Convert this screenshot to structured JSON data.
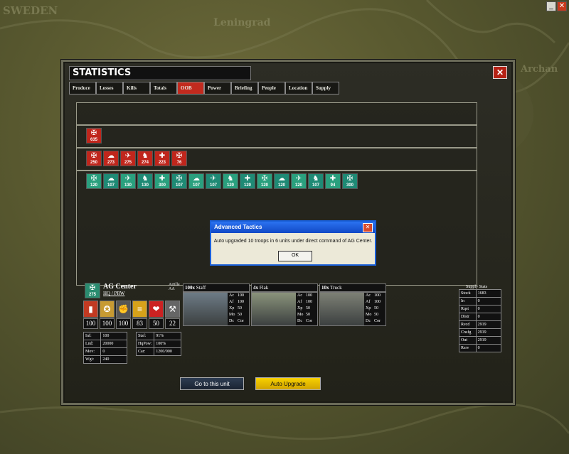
{
  "map": {
    "label_sweden": "SWEDEN",
    "label_leningrad": "Leningrad",
    "label_archangel": "Archan"
  },
  "window_controls": {
    "minimize": "_",
    "close": "✕"
  },
  "title": "STATISTICS",
  "tabs": [
    "Produce",
    "Losses",
    "Kills",
    "Totals",
    "OOB",
    "Power",
    "Briefing",
    "People",
    "Location",
    "Supply"
  ],
  "active_tab": "OOB",
  "oob": {
    "row1": [
      {
        "value": "635",
        "color": "#c0261c"
      }
    ],
    "row2": [
      {
        "value": "250",
        "color": "#c0261c"
      },
      {
        "value": "273",
        "color": "#c0261c"
      },
      {
        "value": "275",
        "color": "#c0261c"
      },
      {
        "value": "274",
        "color": "#c0261c"
      },
      {
        "value": "223",
        "color": "#c0261c"
      },
      {
        "value": "76",
        "color": "#c0261c"
      }
    ],
    "row3": [
      {
        "value": "120"
      },
      {
        "value": "107"
      },
      {
        "value": "130"
      },
      {
        "value": "130"
      },
      {
        "value": "300"
      },
      {
        "value": "107"
      },
      {
        "value": "107"
      },
      {
        "value": "107"
      },
      {
        "value": "120"
      },
      {
        "value": "120"
      },
      {
        "value": "120"
      },
      {
        "value": "120"
      },
      {
        "value": "120"
      },
      {
        "value": "107"
      },
      {
        "value": "94"
      },
      {
        "value": "300"
      }
    ]
  },
  "popup": {
    "title": "Advanced Tactics",
    "message": "Auto upgraded 10 troops in 6 units under direct command of AG Center.",
    "ok_label": "OK"
  },
  "unit": {
    "name": "AG Center",
    "sub": "HQ / PRW",
    "badge_value": "275",
    "stats": [
      "100",
      "100",
      "100",
      "83",
      "50",
      "22"
    ],
    "details": [
      {
        "label": "Inf:",
        "value": "100"
      },
      {
        "label": "Lnd:",
        "value": "20000"
      },
      {
        "label": "Mov:",
        "value": "0"
      },
      {
        "label": "Wgt:",
        "value": "240"
      }
    ],
    "details2": [
      {
        "label": "Staf:",
        "value": "91%"
      },
      {
        "label": "HqPow:",
        "value": "100%"
      },
      {
        "label": "Car:",
        "value": "1200/900"
      }
    ],
    "artillery_label": "Artille AA"
  },
  "troops": [
    {
      "count": "100x",
      "name": "Staff",
      "vals": [
        "100",
        "100",
        "50",
        "50",
        "Cor"
      ],
      "img": "staff"
    },
    {
      "count": "4x",
      "name": "Flak",
      "vals": [
        "100",
        "100",
        "50",
        "50",
        "Cor"
      ],
      "img": "flak"
    },
    {
      "count": "10x",
      "name": "Truck",
      "vals": [
        "100",
        "100",
        "50",
        "50",
        "Cor"
      ],
      "img": "truck"
    }
  ],
  "troop_labels": [
    "Ac",
    "Af",
    "Xp",
    "Mo",
    "Dc"
  ],
  "supply_title": "Supply Stats",
  "supply": [
    {
      "label": "Stock",
      "value": "1683"
    },
    {
      "label": "In",
      "value": "0"
    },
    {
      "label": "Rqst",
      "value": "0"
    },
    {
      "label": "Distr",
      "value": "0"
    },
    {
      "label": "Recd",
      "value": "2919"
    },
    {
      "label": "Cnsfg",
      "value": "2919"
    },
    {
      "label": "Out",
      "value": "2919"
    },
    {
      "label": "Rsrv",
      "value": "0"
    }
  ],
  "buttons": {
    "goto": "Go to this unit",
    "upgrade": "Auto Upgrade"
  }
}
